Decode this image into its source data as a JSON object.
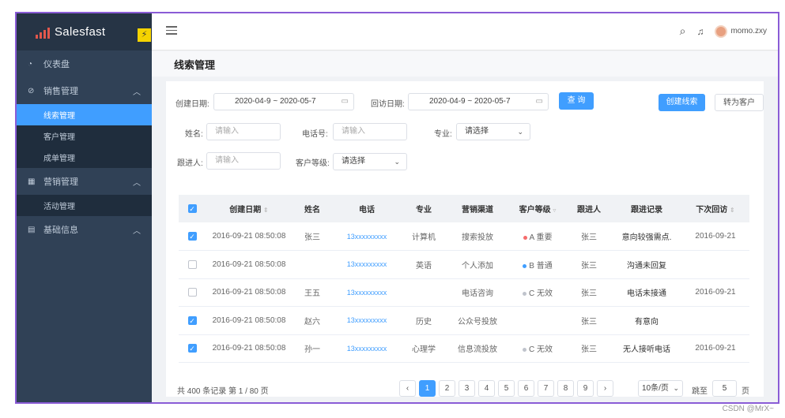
{
  "app": {
    "name": "Salesfast",
    "bolt": "⚡"
  },
  "sidebar": {
    "dashboard": "仪表盘",
    "sales_group": "销售管理",
    "sales_items": [
      "线索管理",
      "客户管理",
      "成单管理"
    ],
    "marketing_group": "营销管理",
    "marketing_items": [
      "活动管理"
    ],
    "basic_group": "基础信息"
  },
  "header": {
    "username": "momo.zxy",
    "page_title": "线索管理"
  },
  "filters": {
    "create_date_label": "创建日期:",
    "create_date_value": "2020-04-9 ~ 2020-05-7",
    "visit_date_label": "回访日期:",
    "visit_date_value": "2020-04-9 ~ 2020-05-7",
    "query_button": "查 询",
    "create_lead_button": "创建线索",
    "convert_button": "转为客户",
    "name_label": "姓名:",
    "name_placeholder": "请输入",
    "phone_label": "电话号:",
    "phone_placeholder": "请输入",
    "major_label": "专业:",
    "major_value": "请选择",
    "follower_label": "跟进人:",
    "follower_placeholder": "请输入",
    "level_label": "客户等级:",
    "level_value": "请选择"
  },
  "table": {
    "headers": [
      "创建日期",
      "姓名",
      "电话",
      "专业",
      "营销渠道",
      "客户等级",
      "跟进人",
      "跟进记录",
      "下次回访"
    ],
    "rows": [
      {
        "checked": true,
        "date": "2016-09-21  08:50:08",
        "name": "张三",
        "phone": "13xxxxxxxxx",
        "major": "计算机",
        "channel": "搜索投放",
        "level": "A 重要",
        "level_color": "#f56c6c",
        "follower": "张三",
        "record": "意向较强需点.",
        "next": "2016-09-21"
      },
      {
        "checked": false,
        "date": "2016-09-21  08:50:08",
        "name": "",
        "phone": "13xxxxxxxxx",
        "major": "英语",
        "channel": "个人添加",
        "level": "B 普通",
        "level_color": "#409eff",
        "follower": "张三",
        "record": "沟通未回复",
        "next": ""
      },
      {
        "checked": false,
        "date": "2016-09-21  08:50:08",
        "name": "王五",
        "phone": "13xxxxxxxxx",
        "major": "",
        "channel": "电话咨询",
        "level": "C 无效",
        "level_color": "#c0c4cc",
        "follower": "张三",
        "record": "电话未接通",
        "next": "2016-09-21"
      },
      {
        "checked": true,
        "date": "2016-09-21  08:50:08",
        "name": "赵六",
        "phone": "13xxxxxxxxx",
        "major": "历史",
        "channel": "公众号投放",
        "level": "",
        "level_color": "",
        "follower": "张三",
        "record": "有意向",
        "next": ""
      },
      {
        "checked": true,
        "date": "2016-09-21  08:50:08",
        "name": "孙一",
        "phone": "13xxxxxxxxx",
        "major": "心理学",
        "channel": "信息流投放",
        "level": "C 无效",
        "level_color": "#c0c4cc",
        "follower": "张三",
        "record": "无人接听电话",
        "next": "2016-09-21"
      }
    ]
  },
  "pagination": {
    "summary": "共 400 条记录 第 1 / 80 页",
    "pages": [
      "1",
      "2",
      "3",
      "4",
      "5",
      "6",
      "7",
      "8",
      "9"
    ],
    "prev": "‹",
    "next": "›",
    "page_size": "10条/页",
    "jump_label": "跳至",
    "jump_value": "5",
    "page_suffix": "页"
  },
  "watermark": "CSDN @MrX~"
}
